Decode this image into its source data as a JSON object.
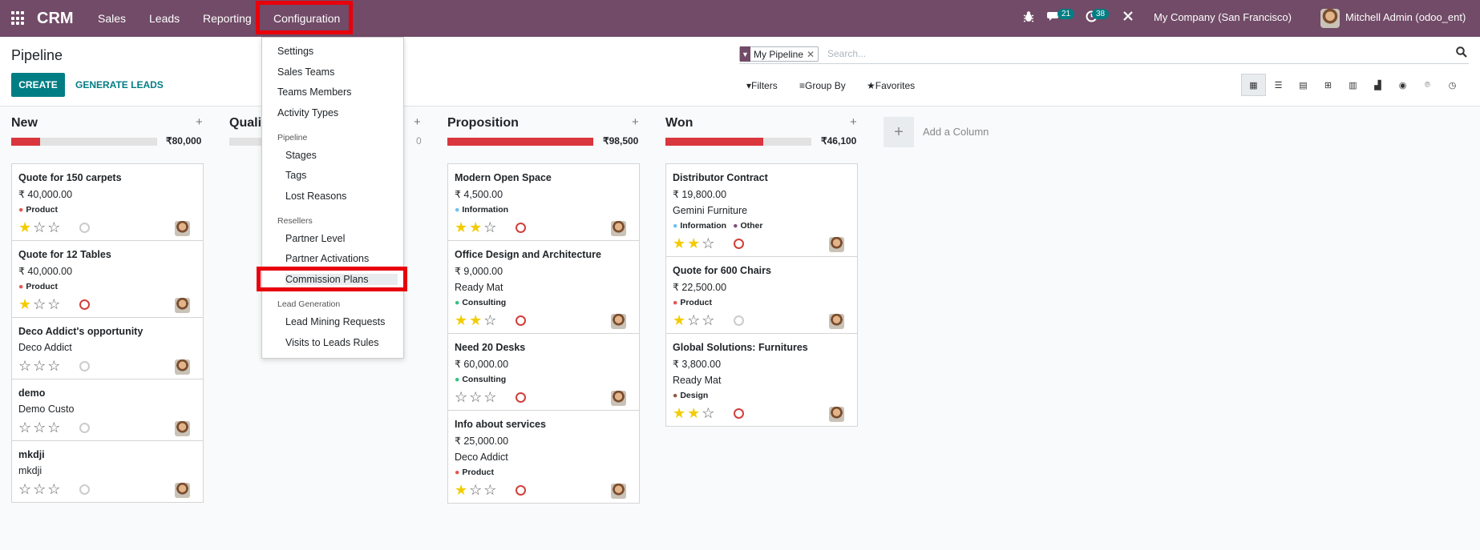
{
  "navbar": {
    "brand": "CRM",
    "menu": [
      "Sales",
      "Leads",
      "Reporting",
      "Configuration"
    ],
    "chat_badge": "21",
    "activity_badge": "38",
    "company": "My Company (San Francisco)",
    "user": "Mitchell Admin (odoo_ent)"
  },
  "control_panel": {
    "title": "Pipeline",
    "create": "CREATE",
    "generate": "GENERATE LEADS",
    "facet": "My Pipeline",
    "search_placeholder": "Search...",
    "filters": "Filters",
    "group_by": "Group By",
    "favorites": "Favorites"
  },
  "dropdown": {
    "settings": "Settings",
    "sales_teams": "Sales Teams",
    "teams_members": "Teams Members",
    "activity_types": "Activity Types",
    "pipeline_head": "Pipeline",
    "stages": "Stages",
    "tags": "Tags",
    "lost_reasons": "Lost Reasons",
    "resellers_head": "Resellers",
    "partner_level": "Partner Level",
    "partner_activations": "Partner Activations",
    "commission_plans": "Commission Plans",
    "lead_gen_head": "Lead Generation",
    "lead_mining": "Lead Mining Requests",
    "visits_rules": "Visits to Leads Rules"
  },
  "columns": {
    "new": {
      "name": "New",
      "total": "₹80,000",
      "progress": 0.2,
      "cards": [
        {
          "name": "Quote for 150 carpets",
          "amount": "₹ 40,000.00",
          "tags": [
            "Product"
          ],
          "stars": 1,
          "late": false
        },
        {
          "name": "Quote for 12 Tables",
          "amount": "₹ 40,000.00",
          "tags": [
            "Product"
          ],
          "stars": 1,
          "late": true
        },
        {
          "name": "Deco Addict's opportunity",
          "sub": "Deco Addict",
          "stars": 0,
          "late": false
        },
        {
          "name": "demo",
          "sub": "Demo Custo",
          "stars": 0,
          "late": false
        },
        {
          "name": "mkdji",
          "sub": "mkdji",
          "stars": 0,
          "late": false
        }
      ]
    },
    "qualified": {
      "name": "Quali",
      "total": "0",
      "progress": 0.0
    },
    "proposition": {
      "name": "Proposition",
      "total": "₹98,500",
      "progress": 1.0,
      "cards": [
        {
          "name": "Modern Open Space",
          "amount": "₹ 4,500.00",
          "tags": [
            "Information"
          ],
          "stars": 2,
          "late": true
        },
        {
          "name": "Office Design and Architecture",
          "amount": "₹ 9,000.00",
          "sub": "Ready Mat",
          "tags": [
            "Consulting"
          ],
          "stars": 2,
          "late": true
        },
        {
          "name": "Need 20 Desks",
          "amount": "₹ 60,000.00",
          "tags": [
            "Consulting"
          ],
          "stars": 0,
          "late": true
        },
        {
          "name": "Info about services",
          "amount": "₹ 25,000.00",
          "sub": "Deco Addict",
          "tags": [
            "Product"
          ],
          "stars": 1,
          "late": true
        }
      ]
    },
    "won": {
      "name": "Won",
      "total": "₹46,100",
      "progress": 0.67,
      "cards": [
        {
          "name": "Distributor Contract",
          "amount": "₹ 19,800.00",
          "sub": "Gemini Furniture",
          "tags": [
            "Information",
            "Other"
          ],
          "stars": 2,
          "late": true
        },
        {
          "name": "Quote for 600 Chairs",
          "amount": "₹ 22,500.00",
          "tags": [
            "Product"
          ],
          "stars": 1,
          "late": false
        },
        {
          "name": "Global Solutions: Furnitures",
          "amount": "₹ 3,800.00",
          "sub": "Ready Mat",
          "tags": [
            "Design"
          ],
          "stars": 2,
          "late": true
        }
      ]
    }
  },
  "add_column": "Add a Column",
  "colors": {
    "primary": "#714b67",
    "accent": "#017e84",
    "danger": "#d9363e",
    "star": "#f3cc00",
    "highlight": "#e8000b"
  }
}
